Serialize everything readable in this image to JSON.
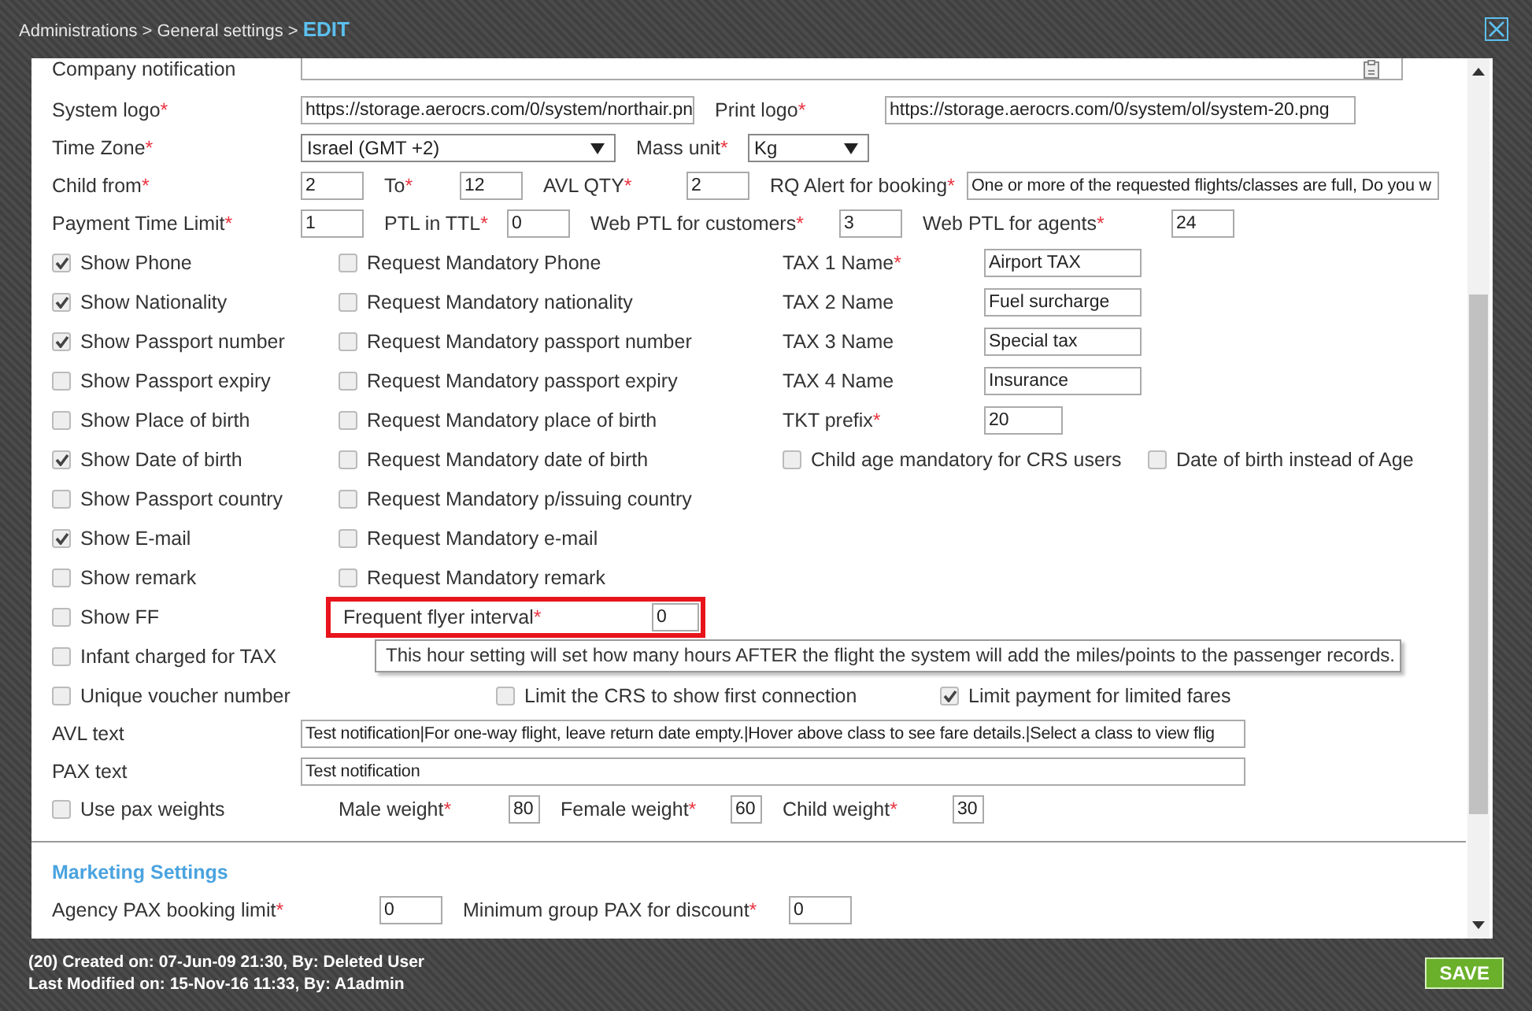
{
  "header": {
    "path": "Administrations > General settings > ",
    "current": "EDIT"
  },
  "form": {
    "company_notification": {
      "label": "Company notification"
    },
    "system_logo": {
      "label": "System logo",
      "req": "*",
      "value": "https://storage.aerocrs.com/0/system/northair.pn"
    },
    "print_logo": {
      "label": "Print logo",
      "req": "*",
      "value": "https://storage.aerocrs.com/0/system/ol/system-20.png"
    },
    "time_zone": {
      "label": "Time Zone",
      "req": "*",
      "value": "Israel (GMT +2)"
    },
    "mass_unit": {
      "label": "Mass unit",
      "req": "*",
      "value": "Kg"
    },
    "child_from": {
      "label": "Child from",
      "req": "*",
      "value": "2"
    },
    "child_to": {
      "label": "To",
      "req": "*",
      "value": "12"
    },
    "avl_qty": {
      "label": "AVL QTY",
      "req": "*",
      "value": "2"
    },
    "rq_alert": {
      "label": "RQ Alert for booking",
      "req": "*",
      "value": "One or more of the requested flights/classes are full, Do you w"
    },
    "payment_time_limit": {
      "label": "Payment Time Limit",
      "req": "*",
      "value": "1"
    },
    "ptl_in_ttl": {
      "label": "PTL in TTL",
      "req": "*",
      "value": "0"
    },
    "web_ptl_customers": {
      "label": "Web PTL for customers",
      "req": "*",
      "value": "3"
    },
    "web_ptl_agents": {
      "label": "Web PTL for agents",
      "req": "*",
      "value": "24"
    },
    "checks": [
      {
        "show": {
          "label": "Show Phone",
          "checked": true
        },
        "request": {
          "label": "Request Mandatory Phone",
          "checked": false
        }
      },
      {
        "show": {
          "label": "Show Nationality",
          "checked": true
        },
        "request": {
          "label": "Request Mandatory nationality",
          "checked": false
        }
      },
      {
        "show": {
          "label": "Show Passport number",
          "checked": true
        },
        "request": {
          "label": "Request Mandatory passport number",
          "checked": false
        }
      },
      {
        "show": {
          "label": "Show Passport expiry",
          "checked": false
        },
        "request": {
          "label": "Request Mandatory passport expiry",
          "checked": false
        }
      },
      {
        "show": {
          "label": "Show Place of birth",
          "checked": false
        },
        "request": {
          "label": "Request Mandatory place of birth",
          "checked": false
        }
      },
      {
        "show": {
          "label": "Show Date of birth",
          "checked": true
        },
        "request": {
          "label": "Request Mandatory date of birth",
          "checked": false
        }
      },
      {
        "show": {
          "label": "Show Passport country",
          "checked": false
        },
        "request": {
          "label": "Request Mandatory p/issuing country",
          "checked": false
        }
      },
      {
        "show": {
          "label": "Show E-mail",
          "checked": true
        },
        "request": {
          "label": "Request Mandatory e-mail",
          "checked": false
        }
      },
      {
        "show": {
          "label": "Show remark",
          "checked": false
        },
        "request": {
          "label": "Request Mandatory remark",
          "checked": false
        }
      }
    ],
    "taxes": [
      {
        "label": "TAX 1 Name",
        "req": "*",
        "value": "Airport TAX"
      },
      {
        "label": "TAX 2 Name",
        "value": "Fuel surcharge"
      },
      {
        "label": "TAX 3 Name",
        "value": "Special tax"
      },
      {
        "label": "TAX 4 Name",
        "value": "Insurance"
      }
    ],
    "tkt_prefix": {
      "label": "TKT prefix",
      "req": "*",
      "value": "20"
    },
    "child_age_mandatory": {
      "label": "Child age mandatory for CRS users",
      "checked": false
    },
    "dob_instead_of_age": {
      "label": "Date of birth instead of Age",
      "checked": false
    },
    "show_ff": {
      "label": "Show FF",
      "checked": false
    },
    "ff_interval": {
      "label": "Frequent flyer interval",
      "req": "*",
      "value": "0",
      "highlighted": true
    },
    "tooltip": "This hour setting will set how many hours AFTER the flight the system will add the miles/points to the passenger records.",
    "infant_charged": {
      "label": "Infant charged for TAX",
      "checked": false
    },
    "unique_voucher": {
      "label": "Unique voucher number",
      "checked": false
    },
    "limit_crs": {
      "label": "Limit the CRS to show first connection",
      "checked": false
    },
    "limit_payment": {
      "label": "Limit payment for limited fares",
      "checked": true
    },
    "avl_text": {
      "label": "AVL text",
      "value": "Test notification|For one-way flight, leave return date empty.|Hover above class to see fare details.|Select a class to view flig"
    },
    "pax_text": {
      "label": "PAX text",
      "value": "Test notification"
    },
    "use_pax_weights": {
      "label": "Use pax weights",
      "checked": false
    },
    "male_weight": {
      "label": "Male weight",
      "req": "*",
      "value": "80"
    },
    "female_weight": {
      "label": "Female weight",
      "req": "*",
      "value": "60"
    },
    "child_weight": {
      "label": "Child weight",
      "req": "*",
      "value": "30"
    }
  },
  "marketing": {
    "title": "Marketing Settings",
    "agency_pax_limit": {
      "label": "Agency PAX booking limit",
      "req": "*",
      "value": "0"
    },
    "min_group_pax": {
      "label": "Minimum group PAX for discount",
      "req": "*",
      "value": "0"
    }
  },
  "footer": {
    "created": "(20) Created on: 07-Jun-09 21:30, By: Deleted User",
    "modified": "Last Modified on: 15-Nov-16 11:33, By: A1admin"
  },
  "save_button": "SAVE"
}
